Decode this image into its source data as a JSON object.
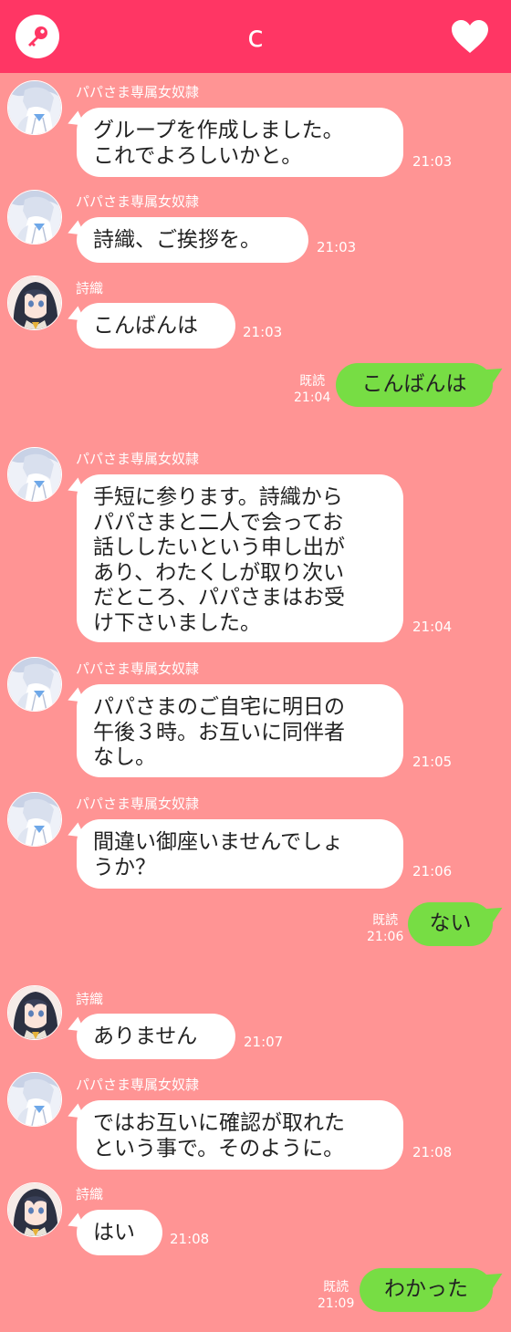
{
  "header": {
    "title": "c",
    "key_icon": "key-icon",
    "heart_icon": "heart-icon",
    "bg_color": "#ff3664"
  },
  "colors": {
    "background": "#ff9494",
    "incoming_bubble": "#ffffff",
    "outgoing_bubble": "#77dd44"
  },
  "messages": [
    {
      "sender": "パパさま専属女奴隷",
      "text": "グループを作成しました。\nこれでよろしいかと。",
      "time": "21:03"
    },
    {
      "sender": "パパさま専属女奴隷",
      "text": "詩織、ご挨拶を。",
      "time": "21:03"
    },
    {
      "sender": "詩織",
      "text": "こんばんは",
      "time": "21:03"
    },
    {
      "read": "既読",
      "text": "こんばんは",
      "time": "21:04"
    },
    {
      "sender": "パパさま専属女奴隷",
      "text": "手短に参ります。詩織から\nパパさまと二人で会ってお\n話ししたいという申し出が\nあり、わたくしが取り次い\nだところ、パパさまはお受\nけ下さいました。",
      "time": "21:04"
    },
    {
      "sender": "パパさま専属女奴隷",
      "text": "パパさまのご自宅に明日の\n午後３時。お互いに同伴者\nなし。",
      "time": "21:05"
    },
    {
      "sender": "パパさま専属女奴隷",
      "text": "間違い御座いませんでしょ\nうか？",
      "time": "21:06"
    },
    {
      "read": "既読",
      "text": "ない",
      "time": "21:06"
    },
    {
      "sender": "詩織",
      "text": "ありません",
      "time": "21:07"
    },
    {
      "sender": "パパさま専属女奴隷",
      "text": "ではお互いに確認が取れた\nという事で。そのように。",
      "time": "21:08"
    },
    {
      "sender": "詩織",
      "text": "はい",
      "time": "21:08"
    },
    {
      "read": "既読",
      "text": "わかった",
      "time": "21:09"
    }
  ]
}
